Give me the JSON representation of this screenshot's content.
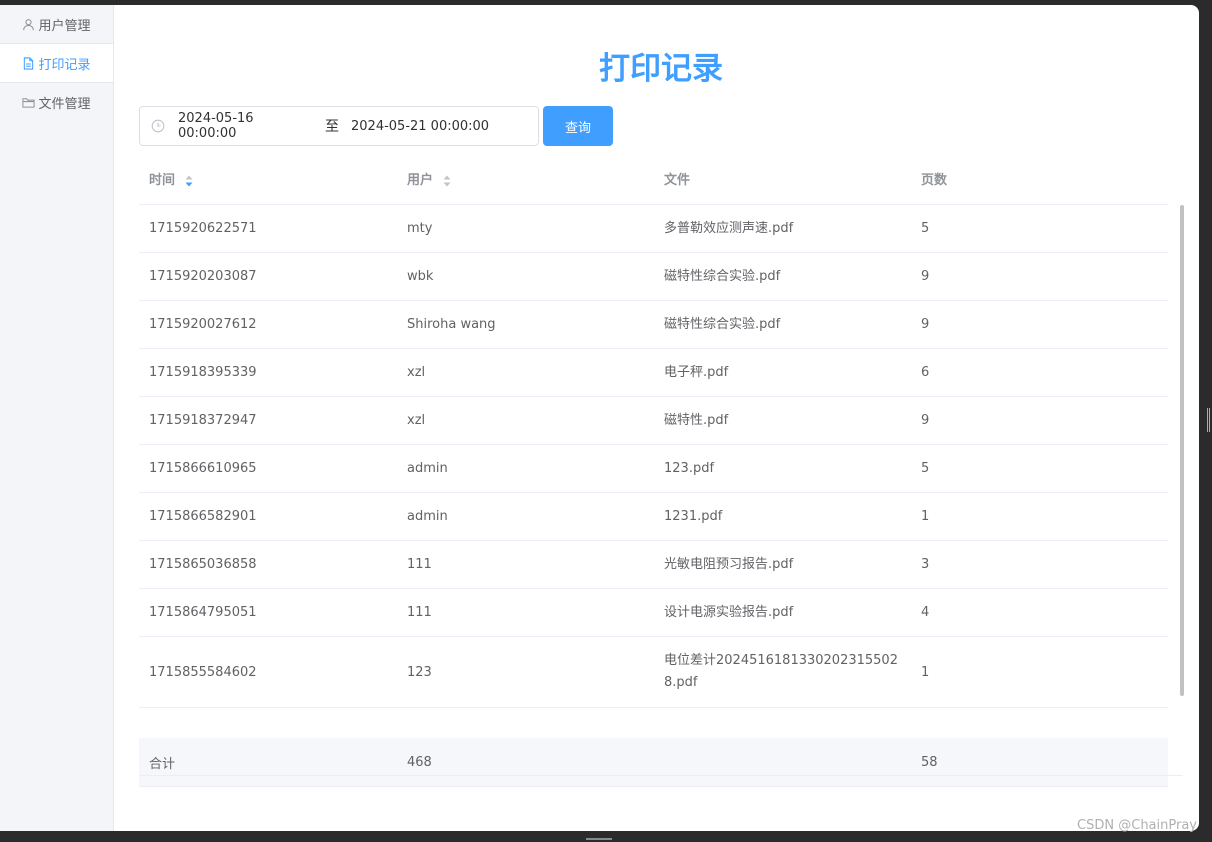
{
  "sidebar": {
    "items": [
      {
        "label": "用户管理",
        "icon": "user-icon"
      },
      {
        "label": "打印记录",
        "icon": "document-icon"
      },
      {
        "label": "文件管理",
        "icon": "folder-icon"
      }
    ],
    "active_index": 1
  },
  "page": {
    "title": "打印记录"
  },
  "filter": {
    "start": "2024-05-16 00:00:00",
    "separator": "至",
    "end": "2024-05-21 00:00:00",
    "query_label": "查询"
  },
  "table": {
    "headers": [
      "时间",
      "用户",
      "文件",
      "页数"
    ],
    "rows": [
      [
        "1715920622571",
        "mty",
        "多普勒效应测声速.pdf",
        "5"
      ],
      [
        "1715920203087",
        "wbk",
        "磁特性综合实验.pdf",
        "9"
      ],
      [
        "1715920027612",
        "Shiroha wang",
        "磁特性综合实验.pdf",
        "9"
      ],
      [
        "1715918395339",
        "xzl",
        "电子秤.pdf",
        "6"
      ],
      [
        "1715918372947",
        "xzl",
        "磁特性.pdf",
        "9"
      ],
      [
        "1715866610965",
        "admin",
        "123.pdf",
        "5"
      ],
      [
        "1715866582901",
        "admin",
        "1231.pdf",
        "1"
      ],
      [
        "1715865036858",
        "111",
        "光敏电阻预习报告.pdf",
        "3"
      ],
      [
        "1715864795051",
        "111",
        "设计电源实验报告.pdf",
        "4"
      ],
      [
        "1715855584602",
        "123",
        "电位差计2024516181330202315502\n8.pdf",
        "1"
      ]
    ],
    "summary": [
      "合计",
      "468",
      "",
      "58"
    ]
  },
  "watermark": "CSDN @ChainPray",
  "colors": {
    "accent": "#409eff",
    "sidebar_bg": "#f4f5f8"
  }
}
